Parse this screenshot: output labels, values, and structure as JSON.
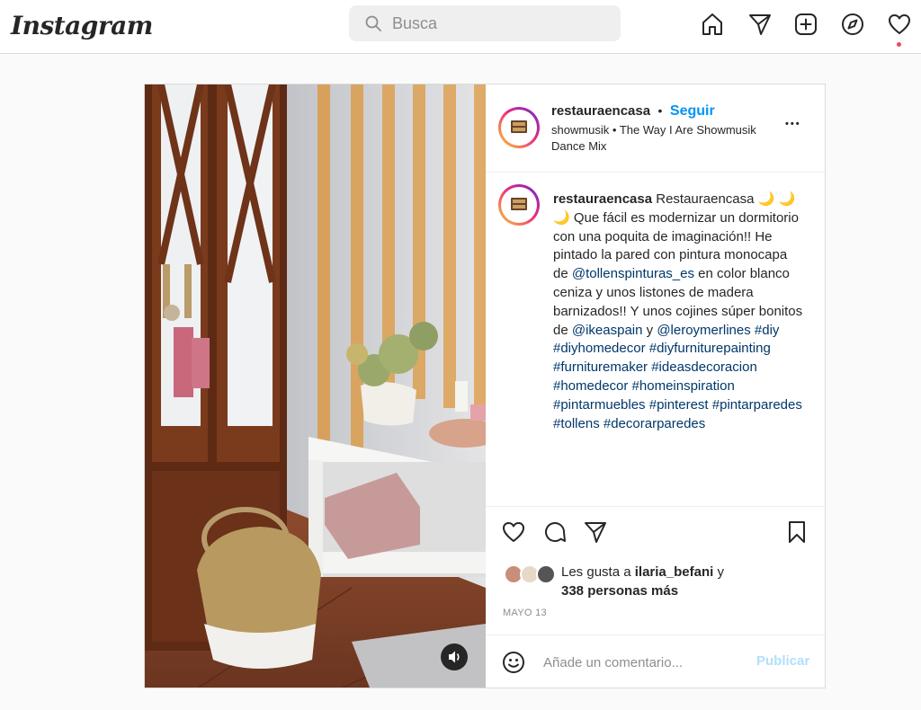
{
  "app": {
    "logo": "Instagram",
    "search_placeholder": "Busca"
  },
  "nav": {
    "icons": [
      "home-icon",
      "send-icon",
      "new-post-icon",
      "explore-icon",
      "heart-icon"
    ],
    "notification_dot_color": "#ed4956"
  },
  "post": {
    "username": "restauraencasa",
    "follow_separator": "•",
    "follow_label": "Seguir",
    "music": "showmusik • The Way I Are Showmusik Dance Mix",
    "more_label": "•••",
    "caption": {
      "username": "restauraencasa",
      "text_1": " Restauraencasa 🌙 🌙 🌙 Que fácil es modernizar un dormitorio con una poquita de imaginación!! He pintado la pared con pintura monocapa de ",
      "mention_1": "@tollenspinturas_es",
      "text_2": " en color blanco ceniza y unos listones de madera barnizados!! Y unos cojines súper bonitos de ",
      "mention_2": "@ikeaspain",
      "text_3": " y ",
      "mention_3": "@leroymerlines",
      "hashtags": "#diy #diyhomedecor #diyfurniturepainting #furnituremaker #ideasdecoracion #homedecor #homeinspiration #pintarmuebles #pinterest #pintarparedes #tollens #decorarparedes"
    },
    "likes": {
      "prefix": "Les gusta a ",
      "user": "ilaria_befani",
      "middle": " y ",
      "others": "338 personas más"
    },
    "date": "MAYO 13",
    "comment_placeholder": "Añade un comentario...",
    "publish_label": "Publicar",
    "colors": {
      "link": "#00376b",
      "follow": "#0095f6",
      "publish_disabled": "#b2dffc"
    }
  }
}
